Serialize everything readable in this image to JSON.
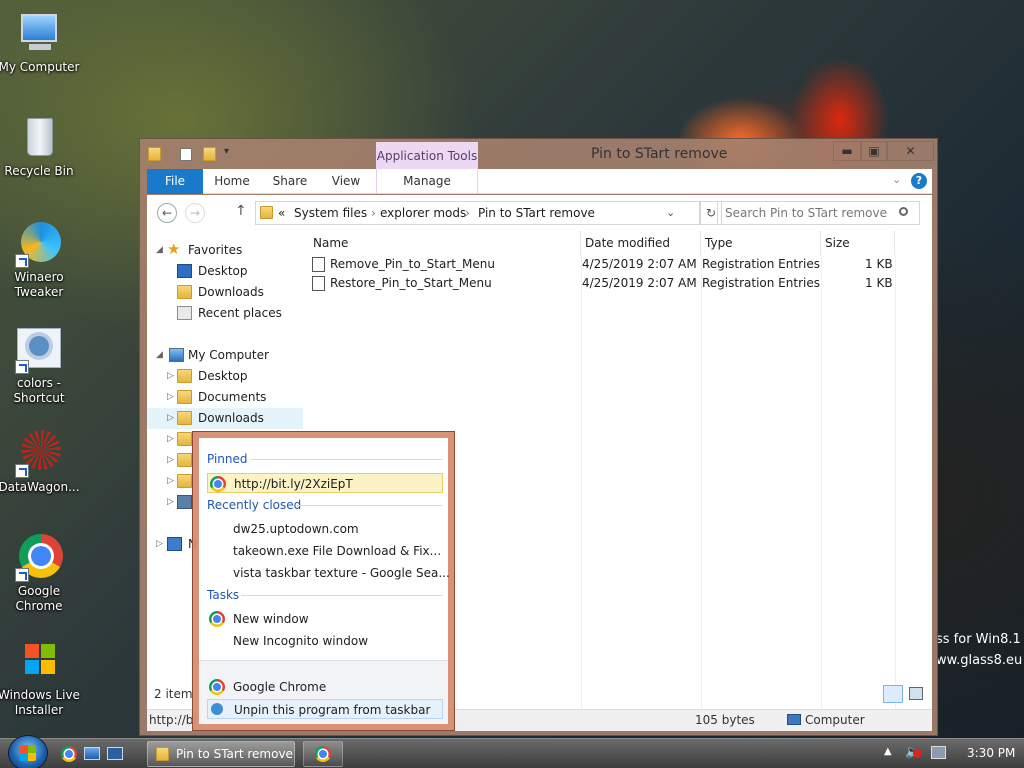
{
  "desktop": {
    "icons": [
      {
        "label": "My Computer",
        "icon": "computer-icon"
      },
      {
        "label": "Recycle Bin",
        "icon": "recycle-bin-icon"
      },
      {
        "label": "Winaero Tweaker",
        "icon": "winaero-icon"
      },
      {
        "label": "colors - Shortcut",
        "icon": "colors-icon"
      },
      {
        "label": "DataWagon...",
        "icon": "datawagon-icon"
      },
      {
        "label": "Google Chrome",
        "icon": "chrome-icon"
      },
      {
        "label": "Windows Live Installer",
        "icon": "windows-icon"
      }
    ],
    "watermark_line1": "ss for Win8.1",
    "watermark_line2": "ww.glass8.eu"
  },
  "window": {
    "title": "Pin to STart remove",
    "app_tools_label": "Application Tools",
    "tabs": {
      "file": "File",
      "home": "Home",
      "share": "Share",
      "view": "View",
      "manage": "Manage"
    },
    "address": {
      "prefix": "«",
      "parts": [
        "System files",
        "explorer mods",
        "Pin to STart remove"
      ]
    },
    "search_placeholder": "Search Pin to STart remove",
    "nav": {
      "favorites": "Favorites",
      "fav_items": [
        "Desktop",
        "Downloads",
        "Recent places"
      ],
      "my_computer": "My Computer",
      "pc_items": [
        "Desktop",
        "Documents",
        "Downloads"
      ],
      "network_partial": "N"
    },
    "columns": {
      "name": "Name",
      "date": "Date modified",
      "type": "Type",
      "size": "Size"
    },
    "files": [
      {
        "name": "Remove_Pin_to_Start_Menu",
        "date": "4/25/2019 2:07 AM",
        "type": "Registration Entries",
        "size": "1 KB"
      },
      {
        "name": "Restore_Pin_to_Start_Menu",
        "date": "4/25/2019 2:07 AM",
        "type": "Registration Entries",
        "size": "1 KB"
      }
    ],
    "status": {
      "items": "2 item",
      "path": "http://bi",
      "size": "105 bytes",
      "location": "Computer"
    }
  },
  "jumplist": {
    "pinned_header": "Pinned",
    "pinned": [
      "http://bit.ly/2XziEpT"
    ],
    "recent_header": "Recently closed",
    "recent": [
      "dw25.uptodown.com",
      "takeown.exe File Download & Fix...",
      "vista taskbar texture - Google Sea..."
    ],
    "tasks_header": "Tasks",
    "tasks": [
      "New window",
      "New Incognito window"
    ],
    "app": "Google Chrome",
    "unpin": "Unpin this program from taskbar"
  },
  "taskbar": {
    "task_label": "Pin to STart remove",
    "clock": "3:30 PM"
  }
}
